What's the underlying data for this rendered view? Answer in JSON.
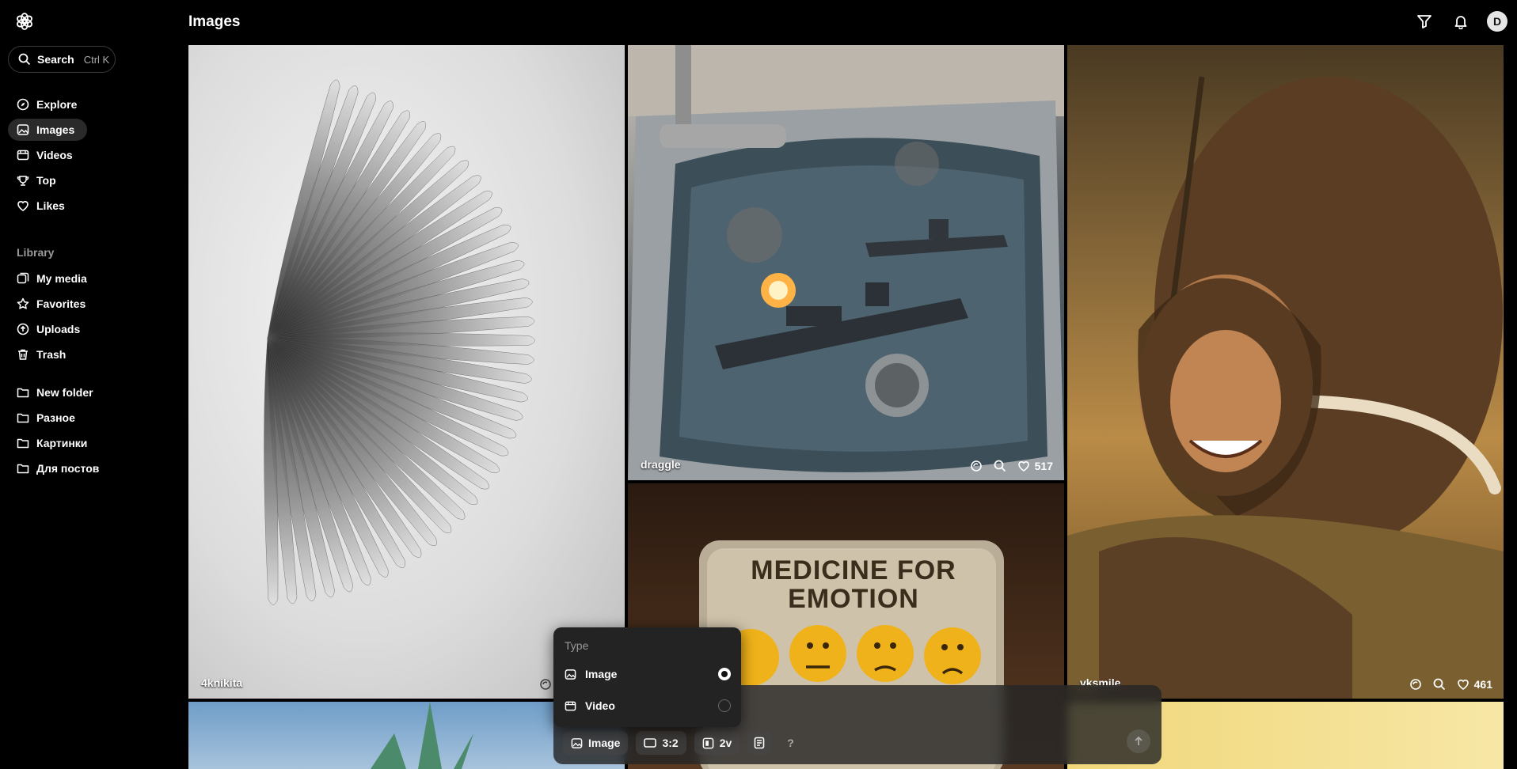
{
  "header": {
    "title": "Images",
    "avatar_letter": "D"
  },
  "search": {
    "label": "Search",
    "shortcut": "Ctrl K"
  },
  "nav": [
    {
      "label": "Explore",
      "icon": "compass-icon"
    },
    {
      "label": "Images",
      "icon": "image-icon"
    },
    {
      "label": "Videos",
      "icon": "video-icon"
    },
    {
      "label": "Top",
      "icon": "trophy-icon"
    },
    {
      "label": "Likes",
      "icon": "heart-icon"
    }
  ],
  "library": {
    "label": "Library",
    "items": [
      {
        "label": "My media",
        "icon": "media-icon"
      },
      {
        "label": "Favorites",
        "icon": "star-icon"
      },
      {
        "label": "Uploads",
        "icon": "upload-icon"
      },
      {
        "label": "Trash",
        "icon": "trash-icon"
      }
    ]
  },
  "folders": [
    {
      "label": "New folder"
    },
    {
      "label": "Разное"
    },
    {
      "label": "Картинки"
    },
    {
      "label": "Для постов"
    }
  ],
  "gallery": [
    {
      "author": "4knikita",
      "likes": ""
    },
    {
      "author": "draggle",
      "likes": "517"
    },
    {
      "author": "vksmile",
      "likes": "461"
    },
    {
      "caption": "MEDICINE FOR EMOTION"
    }
  ],
  "type_menu": {
    "header": "Type",
    "options": [
      {
        "label": "Image",
        "selected": true
      },
      {
        "label": "Video",
        "selected": false
      }
    ]
  },
  "composer": {
    "mode": "Image",
    "aspect": "3:2",
    "variations": "2v",
    "help": "?"
  }
}
